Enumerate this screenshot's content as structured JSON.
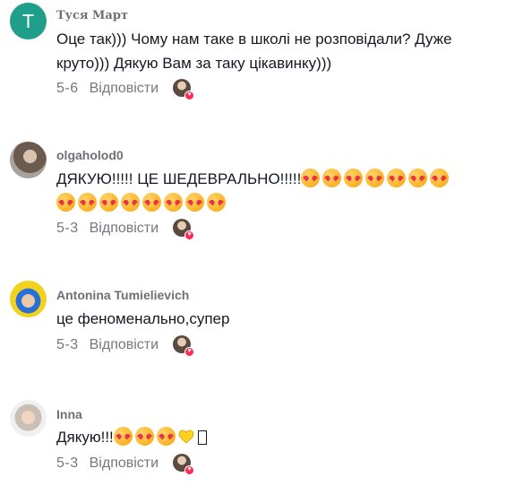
{
  "comments": [
    {
      "username": "Туся Март",
      "avatar_letter": "T",
      "text_line1": "Оце так))) Чому нам таке в школі не розповідали? Дуже",
      "text_line2": "круто))) Дякую Вам за таку цікавинку)))",
      "date": "5-6",
      "reply": "Відповісти"
    },
    {
      "username": "olgaholod0",
      "text": "ДЯКУЮ!!!!! ЦЕ ШЕДЕВРАЛЬНО!!!!!",
      "emoji": "smiling-face-with-hearts",
      "emoji_count": 15,
      "date": "5-3",
      "reply": "Відповісти"
    },
    {
      "username": "Antonina Tumielievich",
      "text": "це феноменально,супер",
      "date": "5-3",
      "reply": "Відповісти"
    },
    {
      "username": "Inna",
      "text": "Дякую!!!",
      "emoji": "smiling-face-with-hearts",
      "emoji_count": 3,
      "extra_emoji": "yellow-heart",
      "date": "5-3",
      "reply": "Відповісти"
    }
  ],
  "colors": {
    "text": "#161823",
    "muted": "#75777c",
    "accent": "#fe2c55",
    "avatar_bg": "#1f9e89"
  }
}
